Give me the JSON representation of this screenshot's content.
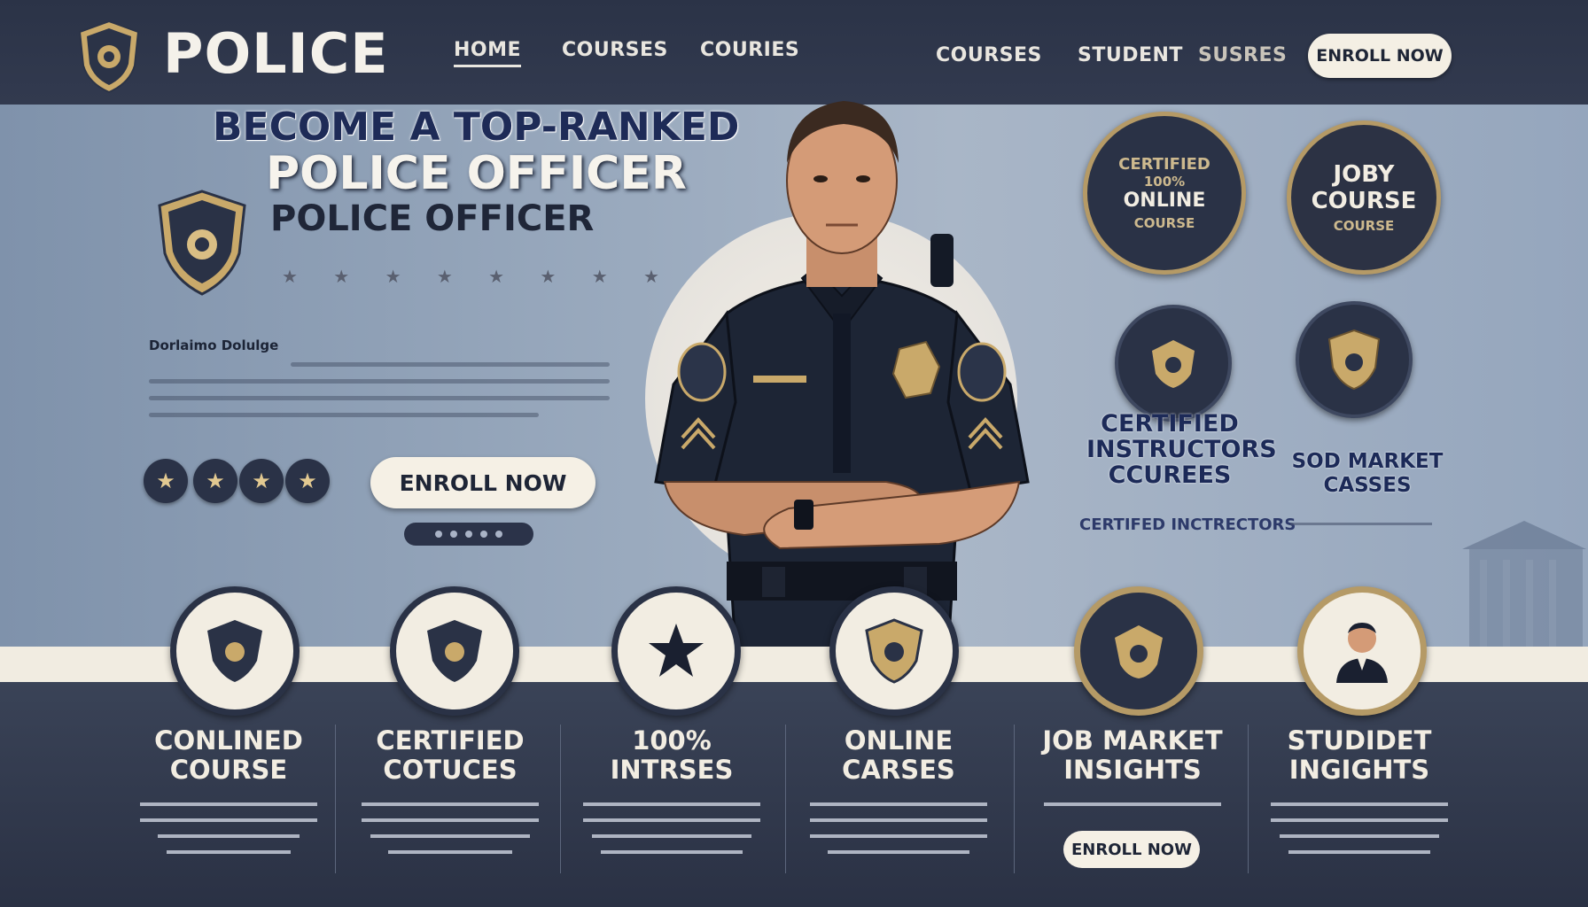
{
  "header": {
    "logo_text": "POLICE",
    "nav": [
      "HOME",
      "COURSES",
      "COURIES",
      "COURSES",
      "STUDENT",
      "SUSRES"
    ],
    "enroll_label": "ENROLL NOW"
  },
  "hero": {
    "headline1": "BECOME A TOP-RANKED",
    "headline2": "POLICE OFFICER",
    "headline3": "POLICE OFFICER",
    "stars": "★ ★ ★ ★ ★  ★ ★ ★",
    "description": "Dorlaimo Dolulge",
    "enroll_label": "ENROLL NOW",
    "rating_stars": [
      "★",
      "★",
      "★",
      "★"
    ]
  },
  "seals": [
    {
      "top": "CERTIFIED",
      "mid1": "100%",
      "mid2": "ONLINE",
      "bottom": "COURSE"
    },
    {
      "mid1": "JOBY",
      "mid2": "COURSE",
      "bottom": "COURSE"
    }
  ],
  "features": [
    {
      "title": "CERTIFIED INSTRUCTORS CCUREES",
      "sub": "CERTIFED INCTRECTORS"
    },
    {
      "title": "SOD MARKET CASSES",
      "sub": ""
    }
  ],
  "cards": [
    {
      "title": "CONLINED COURSE",
      "icon": "badge-icon"
    },
    {
      "title": "CERTIFIED COTUCES",
      "icon": "badge-icon"
    },
    {
      "title": "100% INTRSES",
      "icon": "star-icon"
    },
    {
      "title": "ONLINE CARSES",
      "icon": "badge-icon"
    },
    {
      "title": "JOB MARKET INSIGHTS",
      "icon": "badge-icon",
      "enroll_label": "ENROLL NOW"
    },
    {
      "title": "STUDIDET INGIGHTS",
      "icon": "person-icon"
    }
  ],
  "colors": {
    "navy": "#2a3246",
    "cream": "#f2ede2",
    "gold": "#b59a66",
    "hero_blue": "#9aaabe"
  }
}
